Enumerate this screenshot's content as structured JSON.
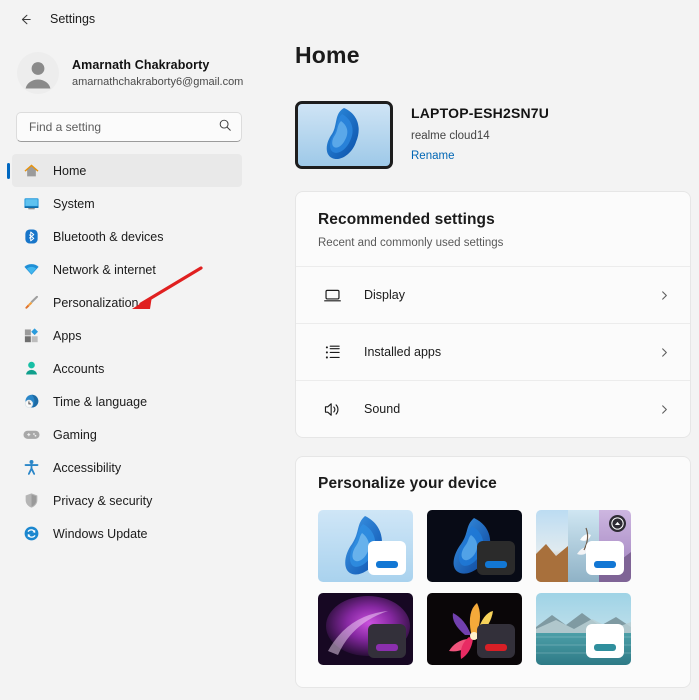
{
  "window": {
    "back_icon": "back-arrow-icon",
    "title": "Settings"
  },
  "account": {
    "avatar_icon": "person-avatar-icon",
    "name": "Amarnath Chakraborty",
    "email": "amarnathchakraborty6@gmail.com"
  },
  "search": {
    "placeholder": "Find a setting",
    "value": "",
    "icon": "search-icon"
  },
  "sidebar": {
    "items": [
      {
        "label": "Home",
        "icon": "home-icon",
        "selected": true
      },
      {
        "label": "System",
        "icon": "monitor-icon",
        "selected": false
      },
      {
        "label": "Bluetooth & devices",
        "icon": "bluetooth-icon",
        "selected": false
      },
      {
        "label": "Network & internet",
        "icon": "wifi-icon",
        "selected": false
      },
      {
        "label": "Personalization",
        "icon": "paintbrush-icon",
        "selected": false
      },
      {
        "label": "Apps",
        "icon": "apps-icon",
        "selected": false
      },
      {
        "label": "Accounts",
        "icon": "account-person-icon",
        "selected": false
      },
      {
        "label": "Time & language",
        "icon": "clock-globe-icon",
        "selected": false
      },
      {
        "label": "Gaming",
        "icon": "gamepad-icon",
        "selected": false
      },
      {
        "label": "Accessibility",
        "icon": "accessibility-icon",
        "selected": false
      },
      {
        "label": "Privacy & security",
        "icon": "shield-icon",
        "selected": false
      },
      {
        "label": "Windows Update",
        "icon": "update-refresh-icon",
        "selected": false
      }
    ]
  },
  "main": {
    "page_title": "Home",
    "device": {
      "name": "LAPTOP-ESH2SN7U",
      "model": "realme cloud14",
      "rename_label": "Rename",
      "thumbnail_icon": "tablet-wallpaper-thumbnail"
    },
    "recommended": {
      "title": "Recommended settings",
      "subtitle": "Recent and commonly used settings",
      "rows": [
        {
          "label": "Display",
          "icon": "display-monitor-icon",
          "chevron": "chevron-right-icon"
        },
        {
          "label": "Installed apps",
          "icon": "list-apps-icon",
          "chevron": "chevron-right-icon"
        },
        {
          "label": "Sound",
          "icon": "speaker-sound-icon",
          "chevron": "chevron-right-icon"
        }
      ]
    },
    "personalize": {
      "title": "Personalize your device",
      "themes": [
        {
          "name": "windows-light-bloom",
          "widget": "light",
          "pill_color": "#1277d4",
          "badge": false
        },
        {
          "name": "windows-dark-bloom",
          "widget": "dark",
          "pill_color": "#1277d4",
          "badge": false
        },
        {
          "name": "flow-landscape-triptych",
          "widget": "light",
          "pill_color": "#1277d4",
          "badge": true
        },
        {
          "name": "glow-purple",
          "widget": "dark",
          "pill_color": "#8b2fae",
          "badge": false
        },
        {
          "name": "captured-motion-flower",
          "widget": "dark",
          "pill_color": "#d81f26",
          "badge": false
        },
        {
          "name": "sunrise-lake",
          "widget": "light",
          "pill_color": "#2f8f9d",
          "badge": false
        }
      ]
    }
  },
  "annotation": {
    "arrow_color": "#e02020",
    "arrow_target": "Personalization"
  }
}
